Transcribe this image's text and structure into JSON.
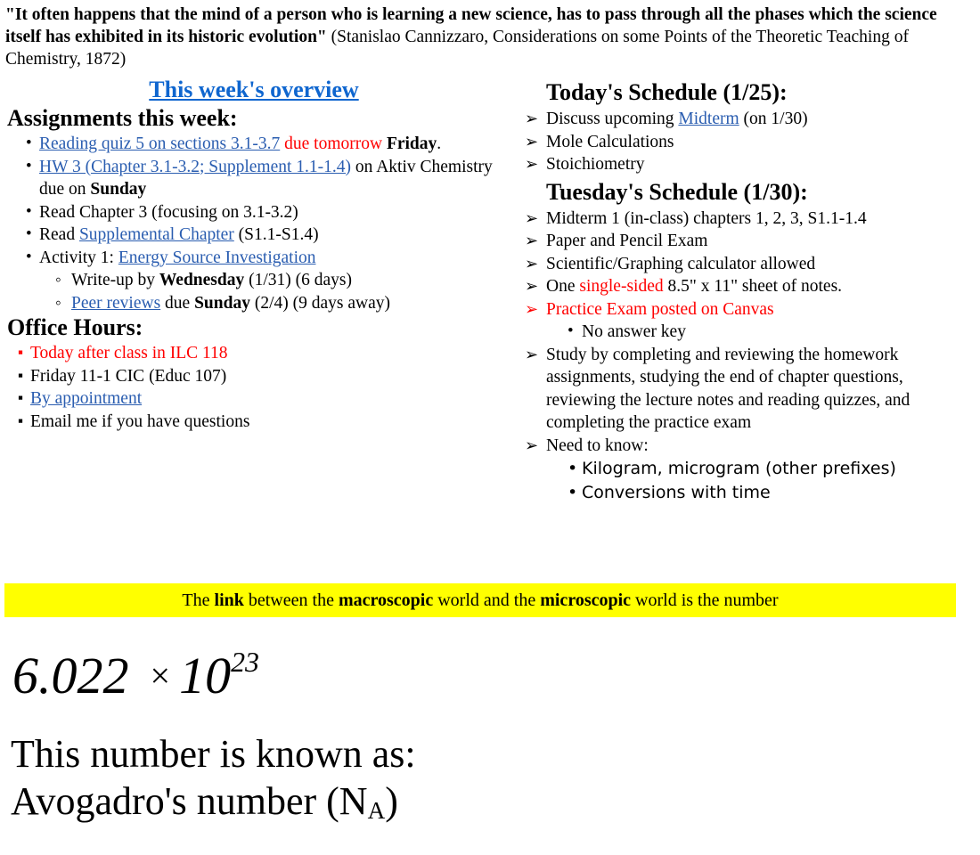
{
  "quote": {
    "text": "\"It often happens that the mind of a person who is learning a new science, has to pass through all the phases which the science itself has exhibited in its historic evolution\"",
    "attribution": " (Stanislao Cannizzaro, Considerations on some Points of the Theoretic Teaching of Chemistry, 1872)"
  },
  "left": {
    "overview_heading": "This week's overview",
    "assignments_heading": "Assignments this week:",
    "assignments": {
      "item1": {
        "link": "Reading quiz 5 on sections 3.1-3.7",
        "red": " due tomorrow ",
        "bold": "Friday",
        "tail": "."
      },
      "item2": {
        "link": "HW 3 (Chapter 3.1-3.2; Supplement 1.1-1.4)",
        "mid": " on Aktiv Chemistry due on ",
        "bold": "Sunday"
      },
      "item3": "Read Chapter 3 (focusing on 3.1-3.2)",
      "item4": {
        "pre": "Read ",
        "link": "Supplemental Chapter",
        "post": " (S1.1-S1.4)"
      },
      "item5": {
        "pre": "Activity 1: ",
        "link": "Energy Source Investigation"
      },
      "sub1": {
        "pre": "Write-up by ",
        "bold": "Wednesday",
        "post": " (1/31) (6 days)"
      },
      "sub2": {
        "link": "Peer reviews",
        "mid": " due ",
        "bold": "Sunday",
        "post": " (2/4) (9 days away)"
      }
    },
    "office_hours_heading": "Office Hours:",
    "office_hours": {
      "item1": "Today after class in ILC 118",
      "item2": "Friday 11-1 CIC (Educ 107)",
      "item3_link": "By appointment",
      "item4": "Email me if you have questions"
    }
  },
  "right": {
    "today_heading": "Today's Schedule (1/25):",
    "today": {
      "item1_pre": "Discuss upcoming ",
      "item1_link": "Midterm",
      "item1_post": " (on 1/30)",
      "item2": "Mole Calculations",
      "item3": "Stoichiometry"
    },
    "tuesday_heading": "Tuesday's Schedule (1/30):",
    "tuesday": {
      "item1": "Midterm 1 (in-class) chapters 1, 2, 3, S1.1-1.4",
      "item2": "Paper and Pencil Exam",
      "item3": "Scientific/Graphing calculator allowed",
      "item4_pre": "One ",
      "item4_red": "single-sided",
      "item4_post": " 8.5\" x 11\" sheet of notes.",
      "item5_red": "Practice Exam posted on Canvas",
      "item5_sub": "No answer key",
      "item6": "Study by completing and reviewing the homework assignments, studying the end of chapter questions, reviewing the lecture notes and reading quizzes, and completing the practice exam",
      "item7": "Need to know:",
      "item7_sub1": "Kilogram, microgram (other prefixes)",
      "item7_sub2": "Conversions with time"
    }
  },
  "highlight": {
    "pre": "The ",
    "b1": "link",
    "mid1": " between the ",
    "b2": "macroscopic",
    "mid2": " world and the ",
    "b3": "microscopic",
    "post": " world is the number"
  },
  "formula": {
    "mantissa": "6.022",
    "operator": "×",
    "base": "10",
    "exponent": "23"
  },
  "closing": {
    "line1": "This number is known as:",
    "line2_pre": "Avogadro's number (N",
    "line2_sub": "A",
    "line2_post": ")"
  },
  "colors": {
    "heading_link": "#0f66cf",
    "body_link": "#2a5db0",
    "accent_red": "#ff0000",
    "highlight": "#ffff00"
  }
}
